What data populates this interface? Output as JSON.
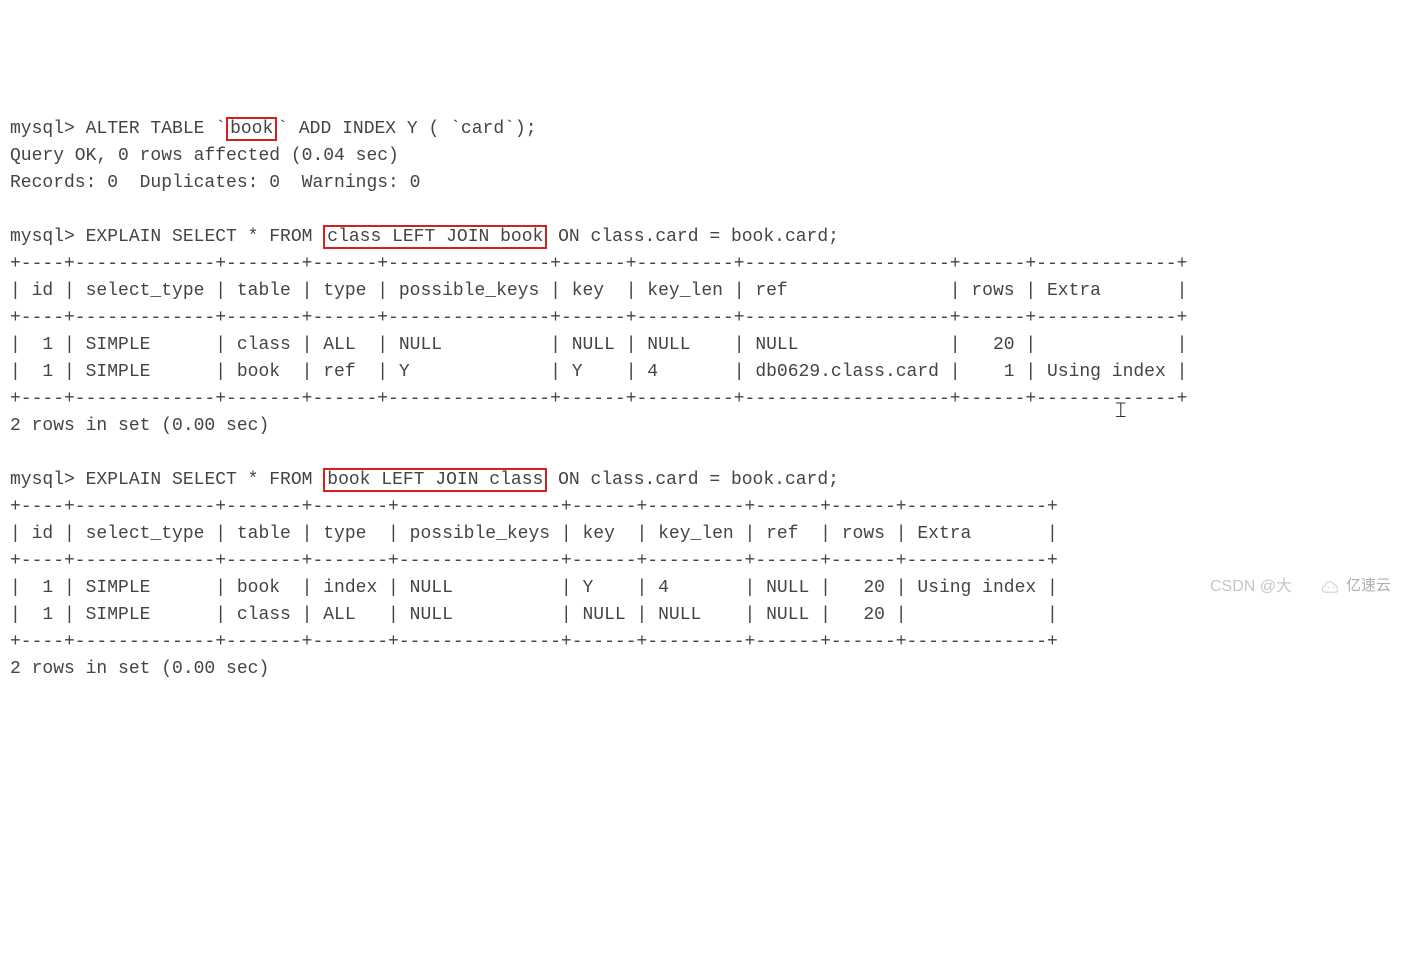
{
  "cmd1": {
    "prompt": "mysql> ",
    "pre": "ALTER TABLE `",
    "hl": "book",
    "post": "` ADD INDEX Y ( `card`);"
  },
  "line_query_ok": "Query OK, 0 rows affected (0.04 sec)",
  "line_records": "Records: 0  Duplicates: 0  Warnings: 0",
  "cmd2": {
    "prompt": "mysql> ",
    "pre": "EXPLAIN SELECT * FROM ",
    "hl": "class LEFT JOIN book",
    "post": " ON class.card = book.card;"
  },
  "t1": {
    "border_top": "+----+-------------+-------+------+---------------+------+---------+-------------------+------+-------------+",
    "header": "| id | select_type | table | type | possible_keys | key  | key_len | ref               | rows | Extra       |",
    "row1": "|  1 | SIMPLE      | class | ALL  | NULL          | NULL | NULL    | NULL              |   20 |             |",
    "row2": "|  1 | SIMPLE      | book  | ref  | Y             | Y    | 4       | db0629.class.card |    1 | Using index |",
    "footer": "2 rows in set (0.00 sec)"
  },
  "cmd3": {
    "prompt": "mysql> ",
    "pre": "EXPLAIN SELECT * FROM ",
    "hl": "book LEFT JOIN class",
    "post": " ON class.card = book.card;"
  },
  "t2": {
    "border_top": "+----+-------------+-------+-------+---------------+------+---------+------+------+-------------+",
    "header": "| id | select_type | table | type  | possible_keys | key  | key_len | ref  | rows | Extra       |",
    "row1": "|  1 | SIMPLE      | book  | index | NULL          | Y    | 4       | NULL |   20 | Using index |",
    "row2": "|  1 | SIMPLE      | class | ALL   | NULL          | NULL | NULL    | NULL |   20 |             |",
    "footer": "2 rows in set (0.00 sec)"
  },
  "watermark_csdn": "CSDN @大",
  "watermark_logo": "亿速云"
}
